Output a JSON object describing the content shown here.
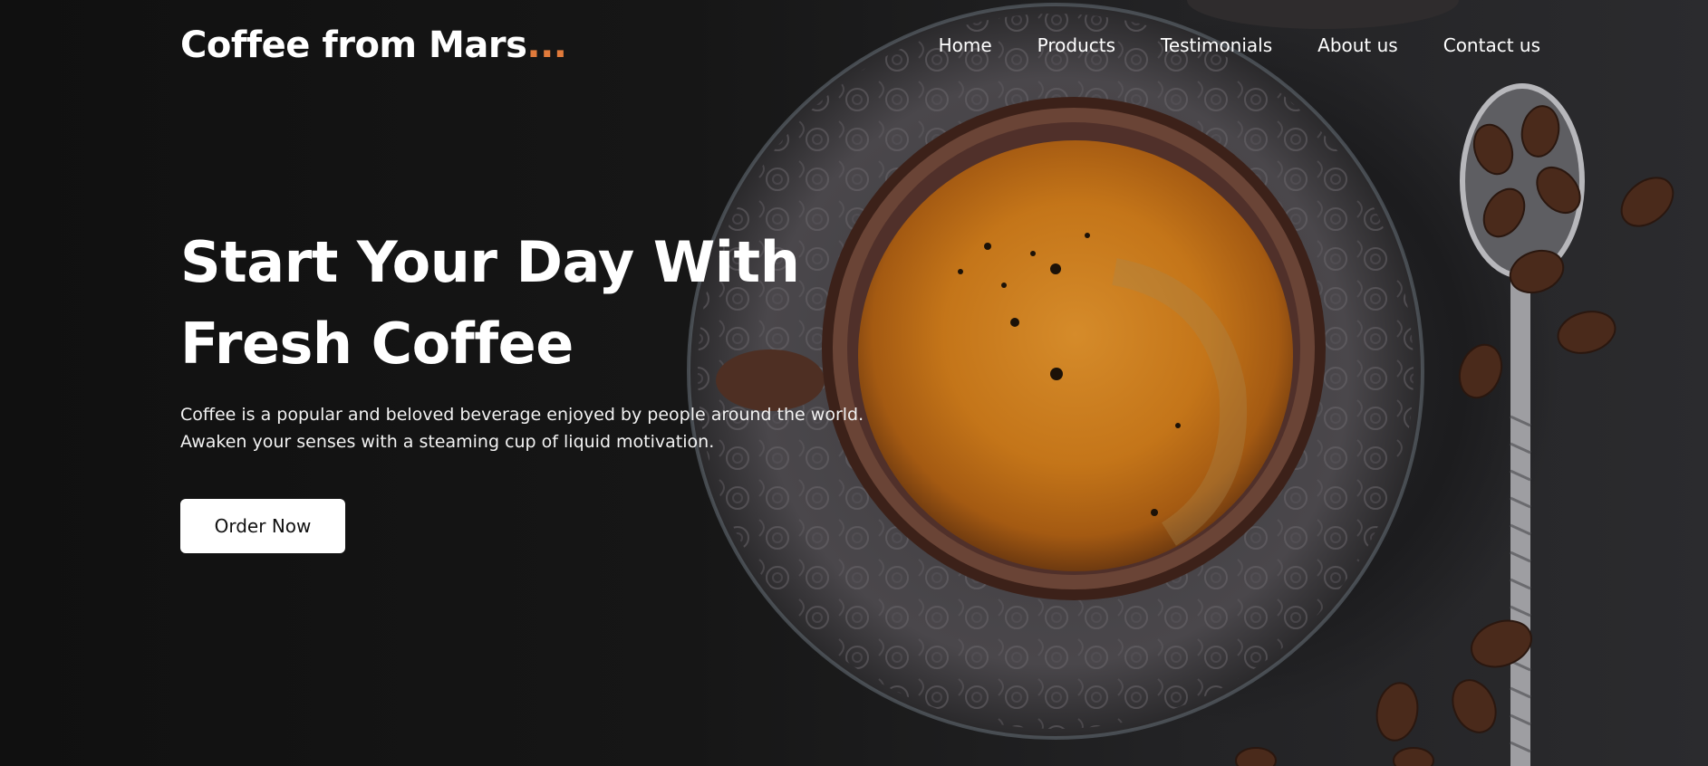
{
  "brand": {
    "name": "Coffee from Mars",
    "dots": "...",
    "accent_color": "#e07a3b"
  },
  "nav": {
    "items": [
      {
        "label": "Home"
      },
      {
        "label": "Products"
      },
      {
        "label": "Testimonials"
      },
      {
        "label": "About us"
      },
      {
        "label": "Contact us"
      }
    ]
  },
  "hero": {
    "title_line1": "Start Your Day With",
    "title_line2": "Fresh Coffee",
    "description": "Coffee is a popular and beloved beverage enjoyed by people around the world. Awaken your senses with a steaming cup of liquid motivation.",
    "cta_label": "Order Now",
    "background_image": "espresso cup on ornate saucer with coffee beans and spoon"
  },
  "colors": {
    "background": "#151515",
    "text": "#ffffff",
    "button_bg": "#ffffff",
    "button_text": "#111111",
    "crema": "#c87a1c"
  }
}
